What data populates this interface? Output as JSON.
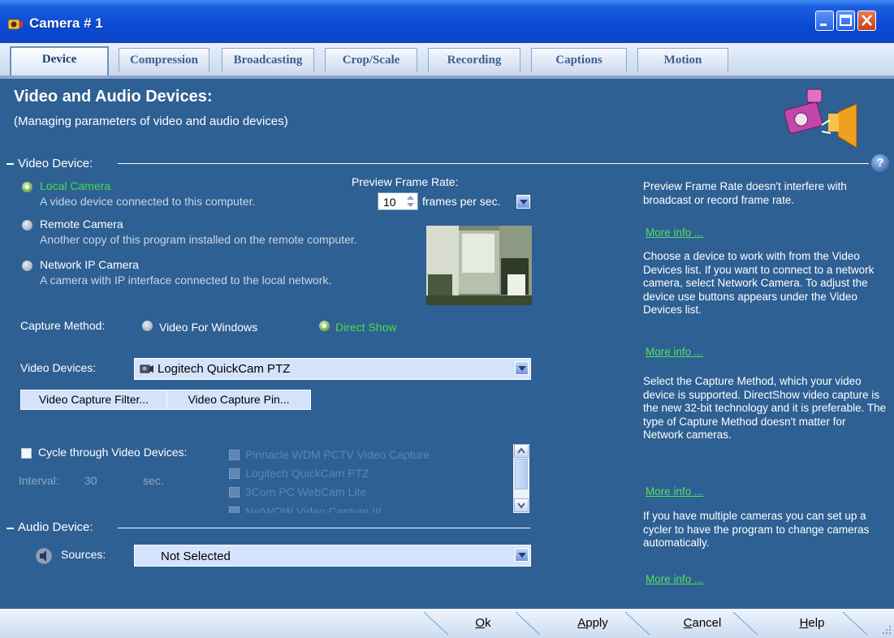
{
  "window": {
    "title": "Camera # 1"
  },
  "tabs": [
    "Device",
    "Compression",
    "Broadcasting",
    "Crop/Scale",
    "Recording",
    "Captions",
    "Motion"
  ],
  "header": {
    "title": "Video and Audio Devices:",
    "subtitle": "(Managing parameters of video and audio devices)"
  },
  "video_device": {
    "section_label": "Video Device:",
    "sources": [
      {
        "label": "Local Camera",
        "description": "A video device connected to this computer.",
        "selected": true
      },
      {
        "label": "Remote Camera",
        "description": "Another copy of this program installed on the remote computer.",
        "selected": false
      },
      {
        "label": "Network IP Camera",
        "description": "A camera with IP interface connected to the local network.",
        "selected": false
      }
    ],
    "preview_frame_rate_label": "Preview Frame Rate:",
    "preview_frame_rate_value": "10",
    "preview_frame_rate_unit": "frames per sec.",
    "capture_method_label": "Capture Method:",
    "capture_methods": [
      {
        "label": "Video For Windows",
        "selected": false
      },
      {
        "label": "Direct Show",
        "selected": true
      }
    ],
    "video_devices_label": "Video Devices:",
    "video_devices_value": "Logitech QuickCam PTZ",
    "capture_filter_button": "Video Capture Filter...",
    "capture_pin_button": "Video Capture Pin...",
    "cycle_label": "Cycle through Video Devices:",
    "cycle_checked": false,
    "interval_label": "Interval:",
    "interval_value": "30",
    "interval_unit": "sec.",
    "cycle_devices": [
      "Pinnacle WDM PCTV Video Capture",
      "Logitech QuickCam PTZ",
      "3Com PC WebCam Lite",
      "NetWOW Video Capture III"
    ]
  },
  "audio_device": {
    "section_label": "Audio Device:",
    "sources_label": "Sources:",
    "sources_value": "Not Selected"
  },
  "help_panel": {
    "help_icon": "?",
    "paragraphs": [
      "Preview Frame Rate doesn't interfere with broadcast or record frame rate.",
      "Choose a device to work with from the Video Devices list. If you want to connect to a network camera, select Network Camera. To adjust the device use buttons appears under the Video Devices list.",
      "Select the Capture Method, which your video device is supported. DirectShow video capture is the new 32-bit technology and it is preferable. The type of Capture Method doesn't matter for Network cameras.",
      "If you have multiple cameras you can set up a cycler to have the program to change cameras automatically."
    ],
    "more_info_label": "More info ..."
  },
  "footer": {
    "ok_key": "O",
    "ok_rest": "k",
    "apply_key": "A",
    "apply_rest": "pply",
    "cancel_key": "C",
    "cancel_rest": "ancel",
    "help_key": "H",
    "help_rest": "elp"
  },
  "colors": {
    "panel_bg": "#2e6094",
    "selected_text": "#43e043",
    "link": "#53e05a"
  }
}
